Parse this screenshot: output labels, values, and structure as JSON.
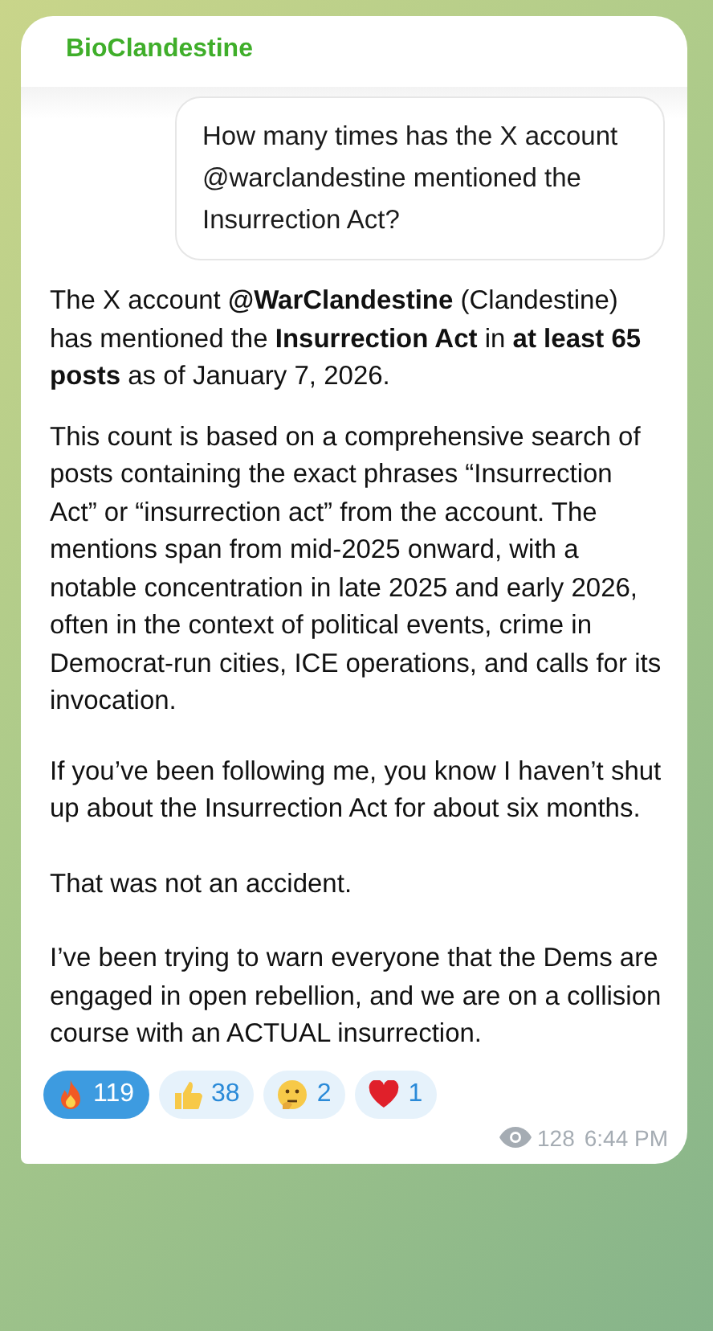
{
  "sender": "BioClandestine",
  "screenshot": {
    "question": "How many times has the X account @warclandestine mentioned the Insurrection Act?",
    "answer": [
      "The X account **@WarClandestine** (Clandestine) has mentioned the **Insurrection Act** in **at least 65 posts** as of January 7, 2026.",
      "This count is based on a comprehensive search of posts containing the exact phrases “Insurrection Act” or “insurrection act” from the account. The mentions span from mid-2025 onward, with a notable concentration in late 2025 and early 2026, often in the context of political events, crime in Democrat-run cities, ICE operations, and calls for its invocation."
    ]
  },
  "message": [
    "If you’ve been following me, you know I haven’t shut up about the Insurrection Act for about six months.",
    "That was not an accident.",
    "I’ve been trying to warn everyone that the Dems are engaged in open rebellion, and we are on a collision course with an ACTUAL insurrection."
  ],
  "reactions": [
    {
      "kind": "fire",
      "count": "119",
      "selected": true
    },
    {
      "kind": "thumbs-up",
      "count": "38",
      "selected": false
    },
    {
      "kind": "thinking",
      "count": "2",
      "selected": false
    },
    {
      "kind": "heart",
      "count": "1",
      "selected": false
    }
  ],
  "views": "128",
  "time": "6:44 PM"
}
